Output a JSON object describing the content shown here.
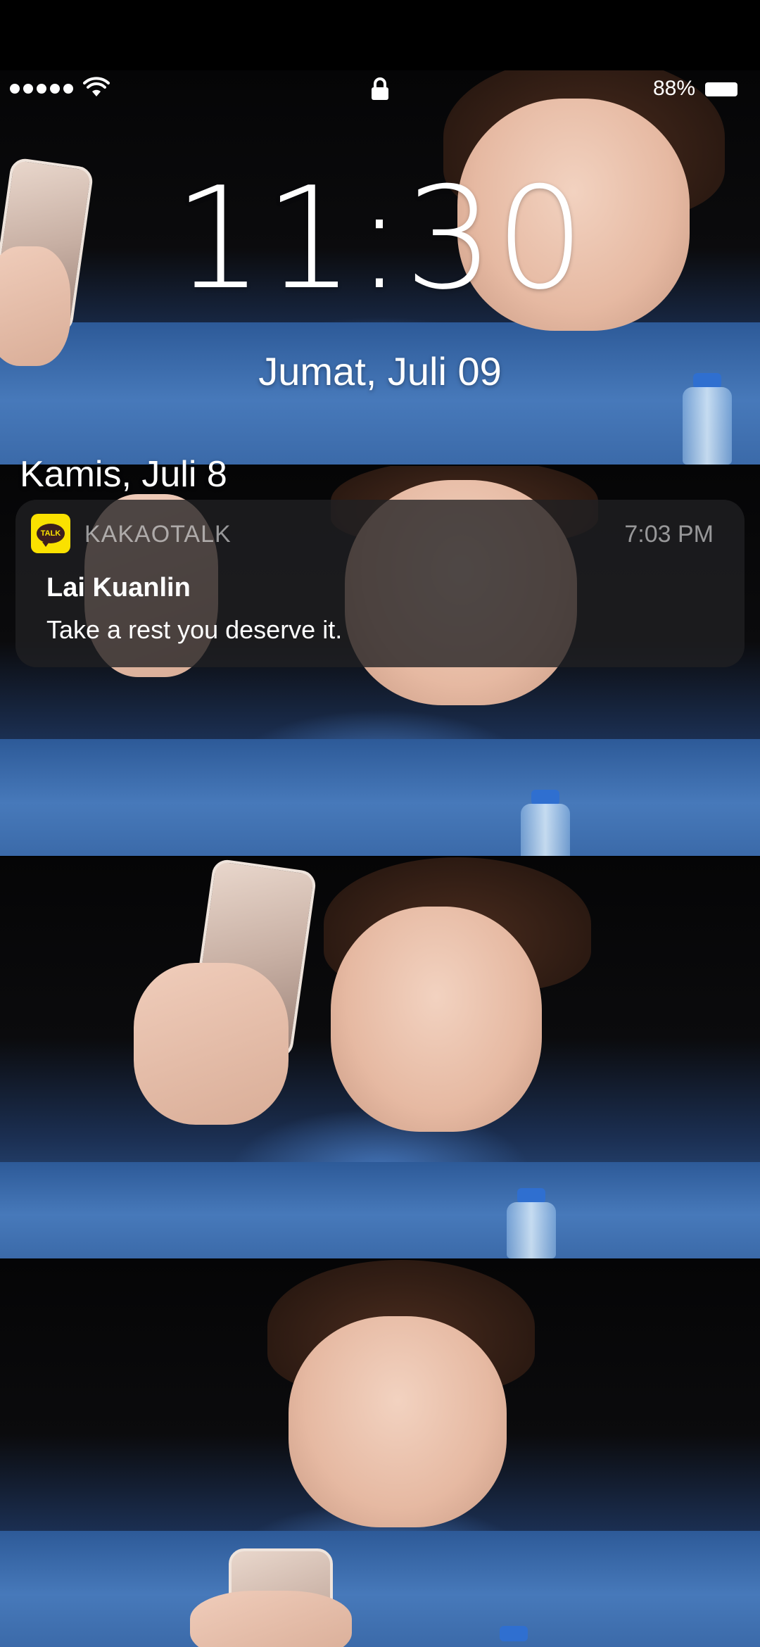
{
  "status_bar": {
    "signal_icon": "signal-dots-icon",
    "wifi_icon": "wifi-icon",
    "lock_icon": "lock-icon",
    "battery_percent": "88%",
    "battery_icon": "battery-icon"
  },
  "lock_screen": {
    "time": "11:30",
    "date": "Jumat, Juli 09"
  },
  "notifications": {
    "group_date": "Kamis, Juli 8",
    "items": [
      {
        "app_name": "KAKAOTALK",
        "app_icon_text": "TALK",
        "app_icon_color": "#fae100",
        "time": "7:03 PM",
        "title": "Lai Kuanlin",
        "body": "Take a rest you deserve it."
      }
    ]
  }
}
